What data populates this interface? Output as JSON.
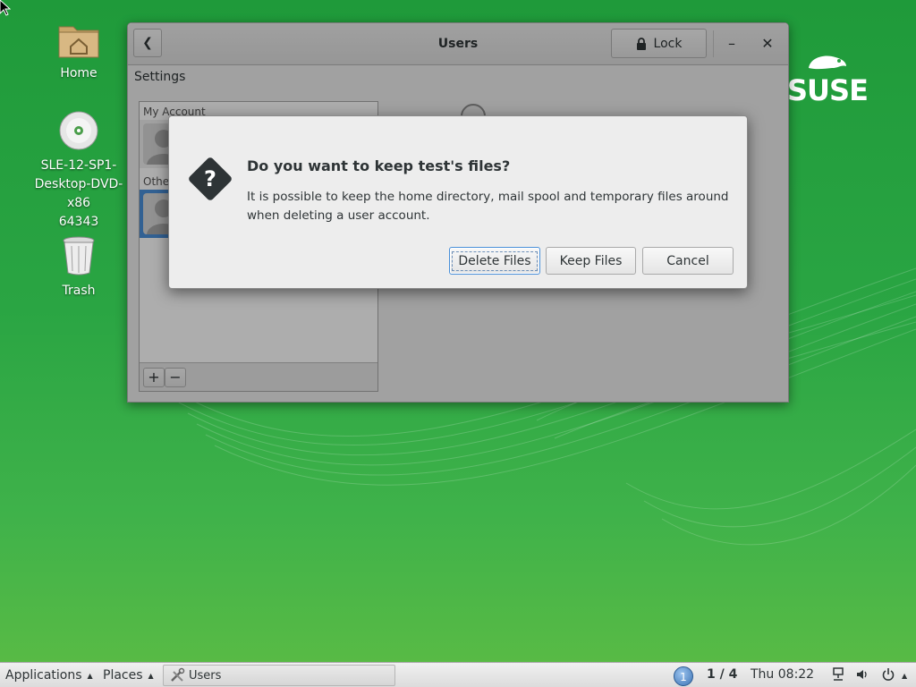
{
  "desktop": {
    "icons": [
      {
        "label": "Home",
        "icon": "home-folder-icon"
      },
      {
        "label": "SLE-12-SP1-Desktop-DVD-x86_64343",
        "label_lines": [
          "SLE-12-SP1-",
          "Desktop-DVD-x86",
          "64343"
        ],
        "icon": "dvd-icon"
      },
      {
        "label": "Trash",
        "icon": "trash-icon"
      }
    ],
    "brand": "SUSE"
  },
  "window": {
    "title": "Users",
    "back_icon": "chevron-left-icon",
    "lock_label": "Lock",
    "minimize_icon": "minimize-icon",
    "close_icon": "close-icon",
    "sidebar_heading": "Settings",
    "sections": {
      "my_account": "My Account",
      "other": "Othe"
    },
    "add_label": "+",
    "remove_label": "−"
  },
  "dialog": {
    "icon": "question-icon",
    "title": "Do you want to keep test's files?",
    "message": "It is possible to keep the home directory, mail spool and temporary files around when deleting a user account.",
    "buttons": {
      "delete": "Delete Files",
      "keep": "Keep Files",
      "cancel": "Cancel"
    }
  },
  "taskbar": {
    "applications": "Applications",
    "places": "Places",
    "task": "Users",
    "workspace_badge": "1",
    "workspace": "1 / 4",
    "clock": "Thu 08:22"
  },
  "colors": {
    "desktop_green": "#2aa543",
    "selection_blue": "#4a90d9"
  }
}
